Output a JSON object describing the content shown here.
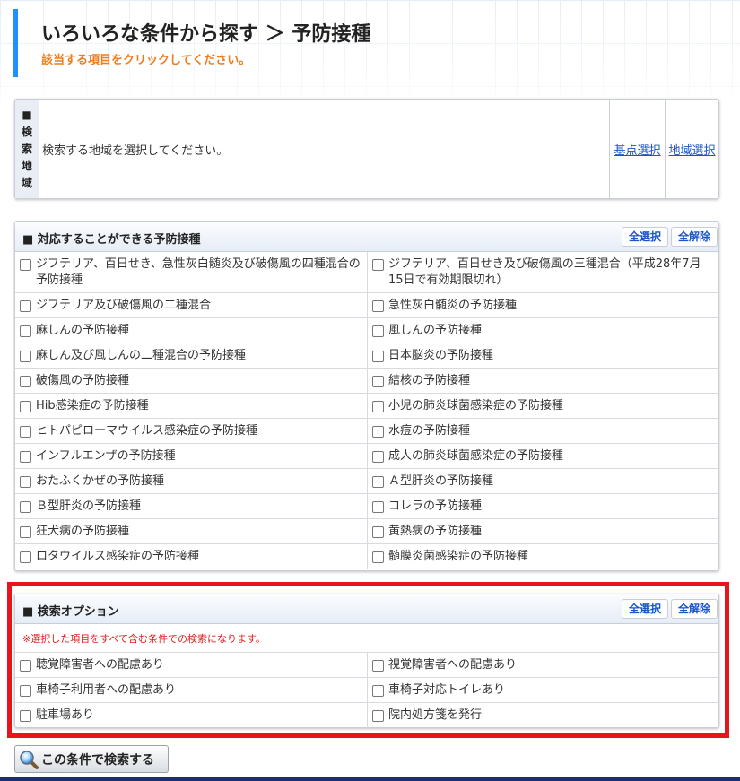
{
  "header": {
    "title": "いろいろな条件から探す ＞ 予防接種",
    "subtitle": "該当する項目をクリックしてください。"
  },
  "region": {
    "label_chars": [
      "■",
      "検",
      "索",
      "地",
      "域"
    ],
    "prompt": "検索する地域を選択してください。",
    "base_select": "基点選択",
    "area_select": "地域選択"
  },
  "vaccinations": {
    "title": "■ 対応することができる予防接種",
    "select_all": "全選択",
    "deselect_all": "全解除",
    "items": [
      "ジフテリア、百日せき、急性灰白髄炎及び破傷風の四種混合の予防接種",
      "ジフテリア、百日せき及び破傷風の三種混合（平成28年7月15日で有効期限切れ）",
      "ジフテリア及び破傷風の二種混合",
      "急性灰白髄炎の予防接種",
      "麻しんの予防接種",
      "風しんの予防接種",
      "麻しん及び風しんの二種混合の予防接種",
      "日本脳炎の予防接種",
      "破傷風の予防接種",
      "結核の予防接種",
      "Hib感染症の予防接種",
      "小児の肺炎球菌感染症の予防接種",
      "ヒトパピローマウイルス感染症の予防接種",
      "水痘の予防接種",
      "インフルエンザの予防接種",
      "成人の肺炎球菌感染症の予防接種",
      "おたふくかぜの予防接種",
      "Ａ型肝炎の予防接種",
      "Ｂ型肝炎の予防接種",
      "コレラの予防接種",
      "狂犬病の予防接種",
      "黄熱病の予防接種",
      "ロタウイルス感染症の予防接種",
      "髄膜炎菌感染症の予防接種"
    ]
  },
  "options": {
    "title": "■ 検索オプション",
    "select_all": "全選択",
    "deselect_all": "全解除",
    "note": "※選択した項目をすべて含む条件での検索になります。",
    "items": [
      "聴覚障害者への配慮あり",
      "視覚障害者への配慮あり",
      "車椅子利用者への配慮あり",
      "車椅子対応トイレあり",
      "駐車場あり",
      "院内処方箋を発行"
    ]
  },
  "search_button": "この条件で検索する",
  "colors": {
    "accent_bar": "#1e90ff",
    "subtitle": "#f07c1c",
    "link": "#1a55c8",
    "highlight_frame": "#e8141c",
    "note": "#e11e1e",
    "footer": "#1c2f6b"
  }
}
